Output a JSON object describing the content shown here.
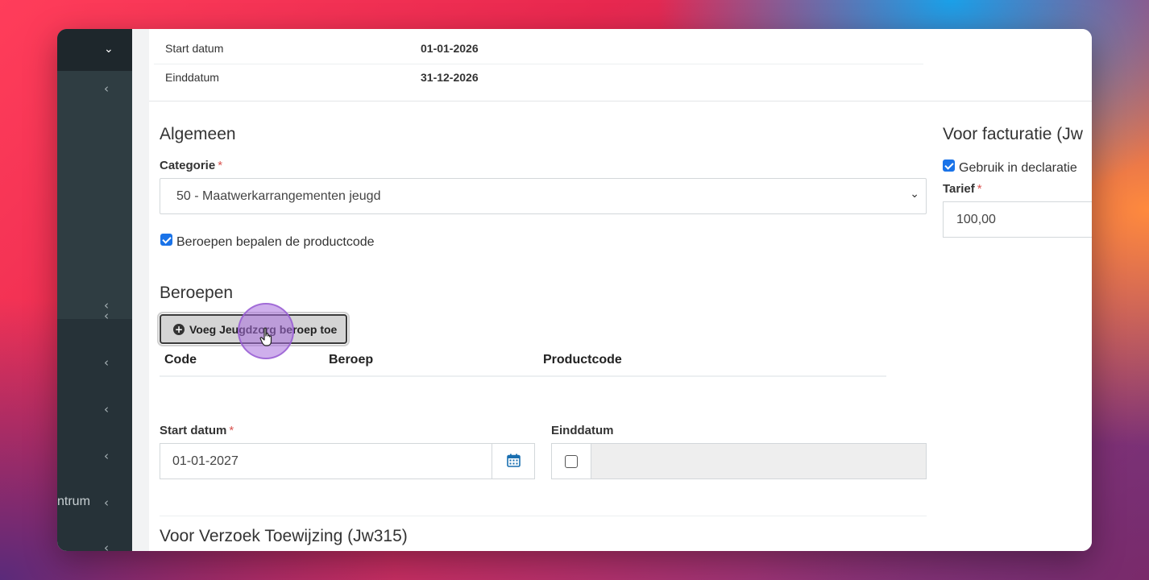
{
  "info": {
    "rows": [
      {
        "label": "Start datum",
        "value": "01-01-2026"
      },
      {
        "label": "Einddatum",
        "value": "31-12-2026"
      }
    ]
  },
  "sidebar": {
    "truncated_label": "ntrum",
    "icons": [
      "chevron-down-icon",
      "chevron-left-icon"
    ]
  },
  "algemeen": {
    "heading": "Algemeen",
    "categorie_label": "Categorie",
    "required_mark": "*",
    "categorie_value": "50 - Maatwerkarrangementen jeugd",
    "beroepen_check_label": "Beroepen bepalen de productcode"
  },
  "beroepen": {
    "heading": "Beroepen",
    "add_button_label": "Voeg Jeugdzorg beroep toe",
    "add_icon_glyph": "+",
    "columns": [
      "Code",
      "Beroep",
      "Productcode"
    ]
  },
  "dates": {
    "start_label": "Start datum",
    "start_value": "01-01-2027",
    "end_label": "Einddatum"
  },
  "verzoek": {
    "heading": "Voor Verzoek Toewijzing (Jw315)"
  },
  "facturatie": {
    "heading": "Voor facturatie (Jw",
    "declaratie_label": "Gebruik in declaratie",
    "tarief_label": "Tarief",
    "tarief_value": "100,00"
  },
  "colors": {
    "sidebar": "#263238",
    "checkbox": "#1a73e8",
    "required": "#d9534f",
    "calendar": "#1a6fb0",
    "cursor": "#a86edc"
  }
}
